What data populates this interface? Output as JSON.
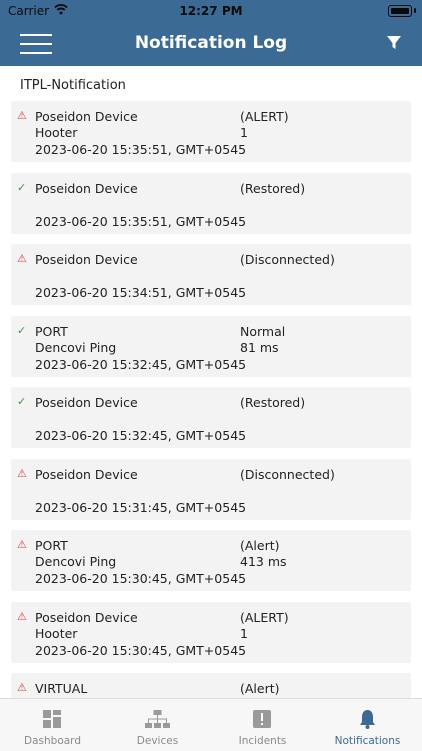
{
  "status": {
    "carrier": "Carrier",
    "time": "12:27 PM"
  },
  "nav": {
    "title": "Notification Log",
    "menu_icon": "hamburger-icon",
    "filter_icon": "filter-icon"
  },
  "section": {
    "title": "ITPL-Notification"
  },
  "notifications": [
    {
      "status": "alert",
      "l1": "Poseidon Device",
      "l2": "Hooter",
      "l3": "2023-06-20 15:35:51, GMT+0545",
      "r1": "(ALERT)",
      "r2": "1"
    },
    {
      "status": "ok",
      "l1": "Poseidon Device",
      "l2": "",
      "l3": "2023-06-20 15:35:51, GMT+0545",
      "r1": "(Restored)",
      "r2": ""
    },
    {
      "status": "alert",
      "l1": "Poseidon Device",
      "l2": "",
      "l3": "2023-06-20 15:34:51, GMT+0545",
      "r1": "(Disconnected)",
      "r2": ""
    },
    {
      "status": "ok",
      "l1": "PORT",
      "l2": "Dencovi Ping",
      "l3": "2023-06-20 15:32:45, GMT+0545",
      "r1": "Normal",
      "r2": "81 ms"
    },
    {
      "status": "ok",
      "l1": "Poseidon Device",
      "l2": "",
      "l3": "2023-06-20 15:32:45, GMT+0545",
      "r1": "(Restored)",
      "r2": ""
    },
    {
      "status": "alert",
      "l1": "Poseidon Device",
      "l2": "",
      "l3": "2023-06-20 15:31:45, GMT+0545",
      "r1": "(Disconnected)",
      "r2": ""
    },
    {
      "status": "alert",
      "l1": "PORT",
      "l2": "Dencovi Ping",
      "l3": "2023-06-20 15:30:45, GMT+0545",
      "r1": "(Alert)",
      "r2": "413 ms"
    },
    {
      "status": "alert",
      "l1": "Poseidon Device",
      "l2": "Hooter",
      "l3": "2023-06-20 15:30:45, GMT+0545",
      "r1": "(ALERT)",
      "r2": "1"
    },
    {
      "status": "alert",
      "l1": "VIRTUAL",
      "l2": "",
      "l3": "",
      "r1": "(Alert)",
      "r2": ""
    }
  ],
  "colors": {
    "primary": "#3b6b94",
    "alert": "#d94141",
    "ok": "#2f9e44",
    "card": "#f3f3f3"
  },
  "tabs": [
    {
      "label": "Dashboard",
      "icon": "dashboard-icon",
      "active": false
    },
    {
      "label": "Devices",
      "icon": "devices-icon",
      "active": false
    },
    {
      "label": "Incidents",
      "icon": "incidents-icon",
      "active": false
    },
    {
      "label": "Notifications",
      "icon": "bell-icon",
      "active": true
    }
  ]
}
